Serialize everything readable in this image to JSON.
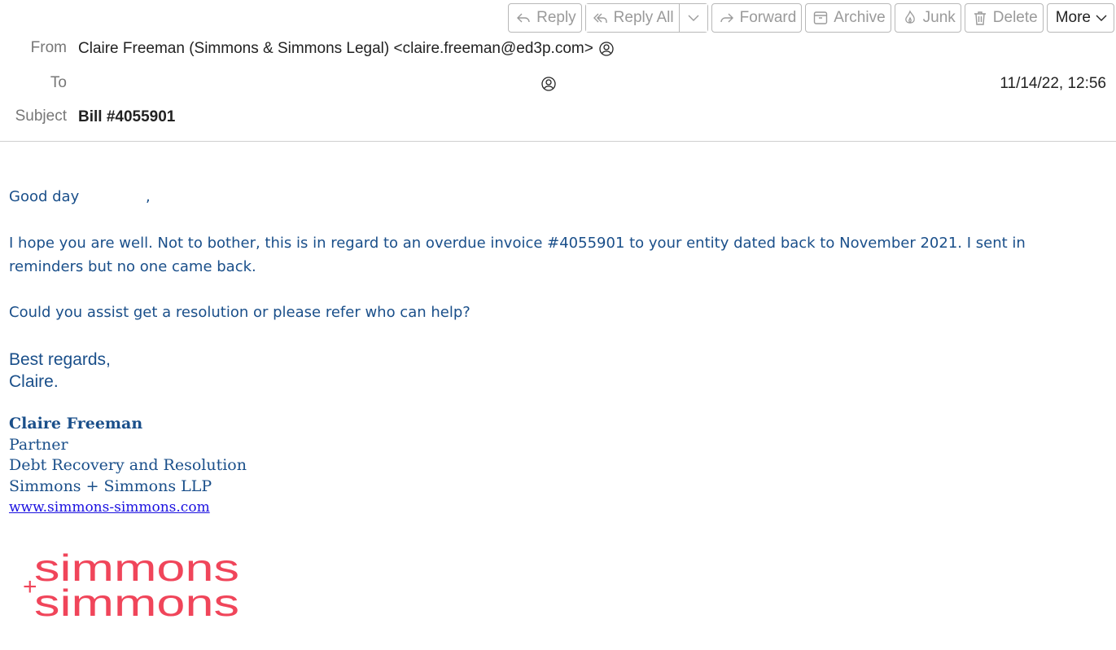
{
  "toolbar": {
    "reply_label": "Reply",
    "reply_all_label": "Reply All",
    "forward_label": "Forward",
    "archive_label": "Archive",
    "junk_label": "Junk",
    "delete_label": "Delete",
    "more_label": "More"
  },
  "header": {
    "from_label": "From",
    "from_value": "Claire Freeman (Simmons & Simmons Legal) <claire.freeman@ed3p.com>",
    "to_label": "To",
    "date": "11/14/22, 12:56",
    "subject_label": "Subject",
    "subject_value": "Bill #4055901"
  },
  "body": {
    "greeting_start": "Good day",
    "greeting_end": ",",
    "paragraph1": "I hope you are well. Not to bother, this is in regard to an overdue invoice #4055901 to your entity dated back to November 2021. I sent in reminders but no one came back.",
    "paragraph2": "Could you assist get a resolution or please refer who can help?",
    "closing1": "Best regards,",
    "closing2": "Claire."
  },
  "signature": {
    "name": "Claire Freeman",
    "title": "Partner",
    "department": "Debt Recovery and Resolution",
    "firm": "Simmons + Simmons LLP",
    "website": "www.simmons-simmons.com"
  },
  "logo": {
    "line1": "simmons",
    "line2": "simmons",
    "plus": "+",
    "color": "#f0455a"
  },
  "colors": {
    "body_text": "#1a4f8a",
    "link": "#1a10e0",
    "toolbar_text": "#9a9a9a",
    "border": "#b8b8b8"
  }
}
